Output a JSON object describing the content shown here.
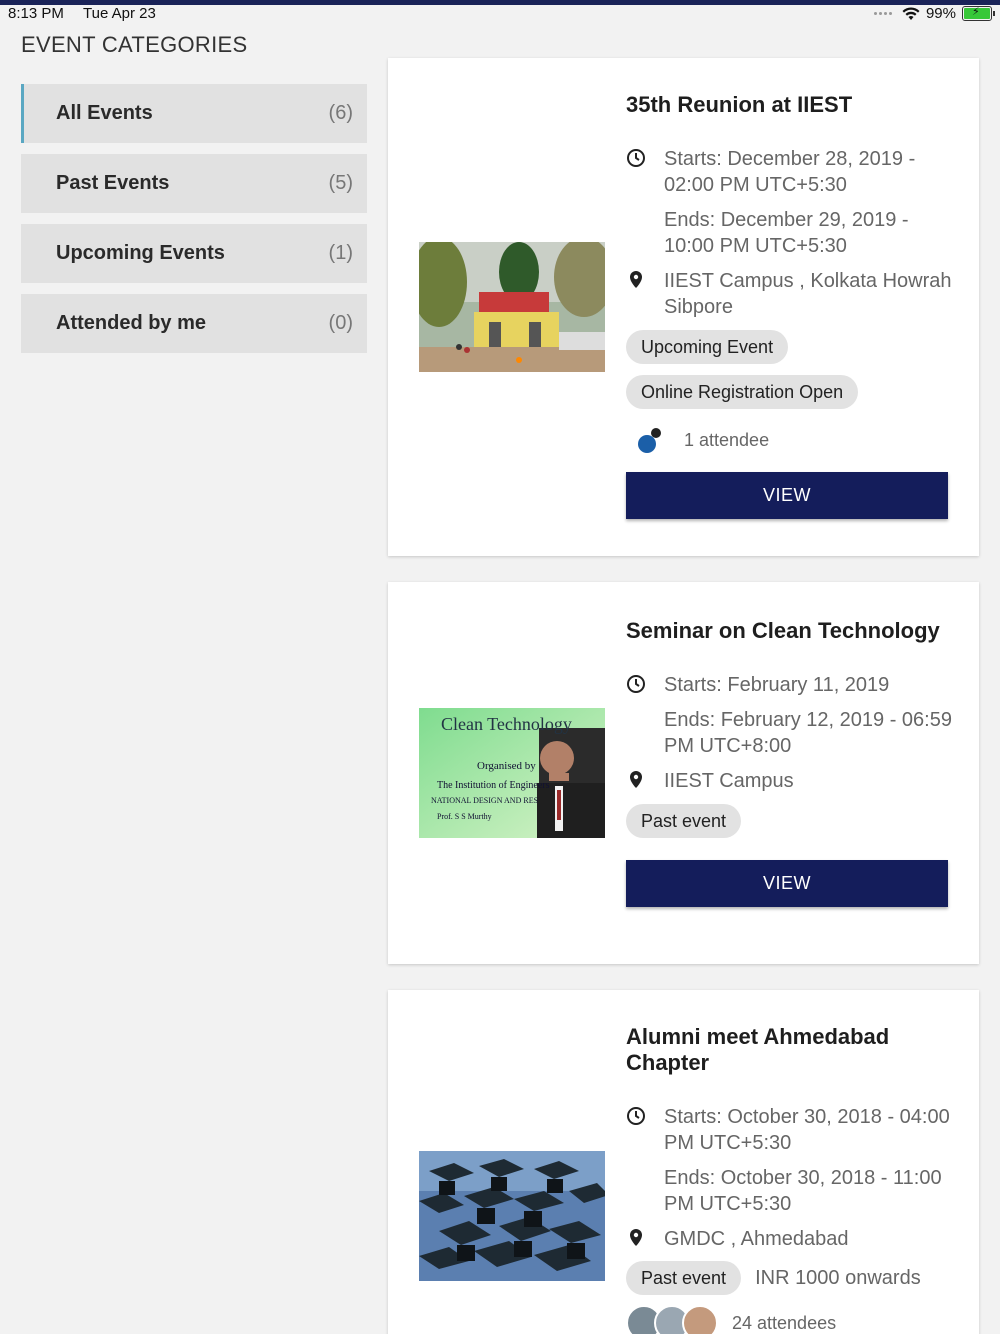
{
  "status": {
    "time": "8:13 PM",
    "date": "Tue Apr 23",
    "battery": "99%"
  },
  "categories": {
    "title": "EVENT CATEGORIES",
    "items": [
      {
        "label": "All Events",
        "count": "(6)"
      },
      {
        "label": "Past Events",
        "count": "(5)"
      },
      {
        "label": "Upcoming Events",
        "count": "(1)"
      },
      {
        "label": "Attended by me",
        "count": "(0)"
      }
    ]
  },
  "events": [
    {
      "title": "35th Reunion at IIEST",
      "starts": "Starts: December 28, 2019 - 02:00 PM UTC+5:30",
      "ends": "Ends: December 29, 2019 - 10:00 PM UTC+5:30",
      "location": "IIEST Campus , Kolkata Howrah Sibpore",
      "chips": [
        "Upcoming Event",
        "Online Registration Open"
      ],
      "attendees": "1 attendee",
      "button": "VIEW"
    },
    {
      "title": "Seminar on Clean Technology",
      "starts": "Starts: February 11, 2019",
      "ends": "Ends: February 12, 2019 - 06:59 PM UTC+8:00",
      "location": "IIEST Campus",
      "chips": [
        "Past event"
      ],
      "button": "VIEW",
      "image_text": {
        "line1": "Clean Technology",
        "line2": "Organised by",
        "line3": "The Institution of Engineers",
        "line4": "NATIONAL DESIGN AND RES",
        "line5": "Prof. S S Murthy"
      }
    },
    {
      "title": "Alumni meet Ahmedabad Chapter",
      "starts": "Starts: October 30, 2018 - 04:00 PM UTC+5:30",
      "ends": "Ends: October 30, 2018 - 11:00 PM UTC+5:30",
      "location": "GMDC , Ahmedabad",
      "chips": [
        "Past event"
      ],
      "price": "INR 1000 onwards",
      "attendees": "24 attendees"
    }
  ]
}
